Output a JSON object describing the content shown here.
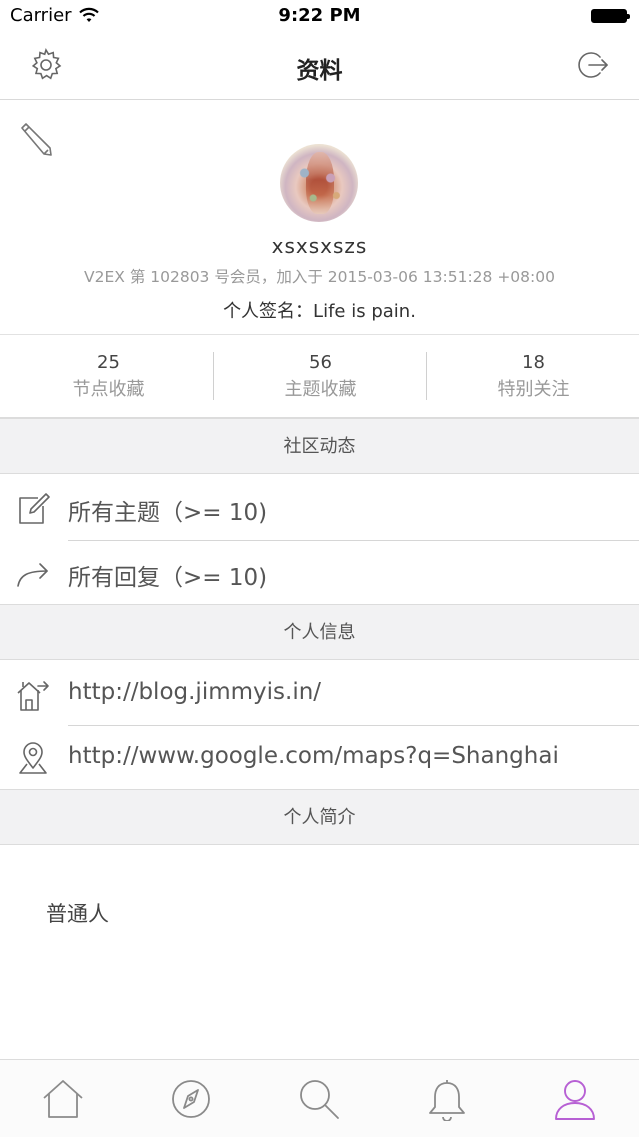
{
  "status_bar": {
    "carrier": "Carrier",
    "time": "9:22 PM"
  },
  "nav": {
    "title": "资料"
  },
  "profile": {
    "username": "xsxsxszs",
    "member_info": "V2EX 第 102803 号会员，加入于 2015-03-06 13:51:28 +08:00",
    "signature": "个人签名：Life is pain."
  },
  "stats": [
    {
      "count": "25",
      "label": "节点收藏"
    },
    {
      "count": "56",
      "label": "主题收藏"
    },
    {
      "count": "18",
      "label": "特别关注"
    }
  ],
  "sections": {
    "community": {
      "header": "社区动态",
      "rows": [
        {
          "icon": "compose-icon",
          "label": "所有主题（>= 10)"
        },
        {
          "icon": "reply-arrow-icon",
          "label": "所有回复（>= 10)"
        }
      ]
    },
    "personal_info": {
      "header": "个人信息",
      "rows": [
        {
          "icon": "home-link-icon",
          "label": "http://blog.jimmyis.in/"
        },
        {
          "icon": "location-pin-icon",
          "label": "http://www.google.com/maps?q=Shanghai"
        }
      ]
    },
    "bio": {
      "header": "个人简介",
      "text": "普通人"
    }
  },
  "tabbar": {
    "items": [
      {
        "icon": "home-icon"
      },
      {
        "icon": "compass-icon"
      },
      {
        "icon": "search-icon"
      },
      {
        "icon": "bell-icon"
      },
      {
        "icon": "profile-icon",
        "active": true
      }
    ],
    "active_color": "#b760d4",
    "inactive_color": "#8a8a8a"
  }
}
